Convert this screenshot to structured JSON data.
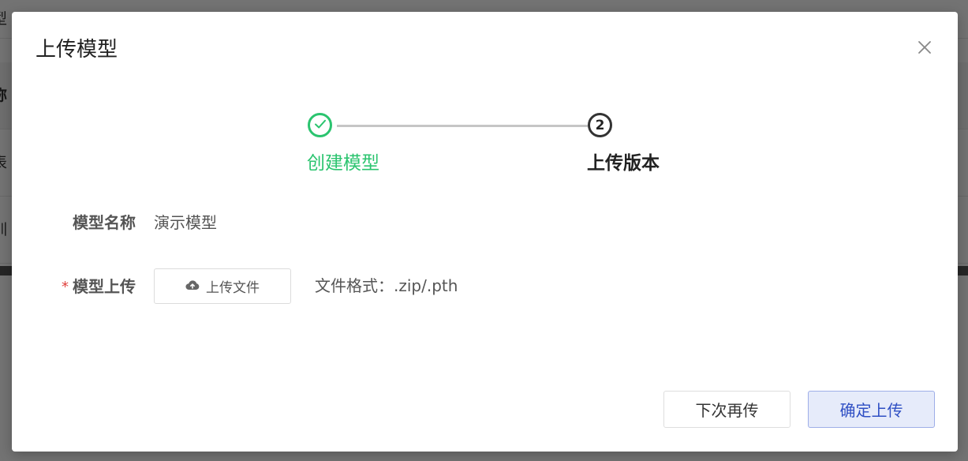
{
  "background": {
    "rows": [
      "型",
      "称",
      "表",
      "训"
    ]
  },
  "modal": {
    "title": "上传模型",
    "close_icon": "close-icon",
    "steps": [
      {
        "label": "创建模型",
        "status": "finish",
        "icon": "check-icon",
        "color": "#2bc46f"
      },
      {
        "label": "上传版本",
        "status": "process",
        "number": "2",
        "color": "#222222"
      }
    ],
    "form": {
      "name_label": "模型名称",
      "name_value": "演示模型",
      "upload_required": "*",
      "upload_label": "模型上传",
      "upload_button_label": "上传文件",
      "upload_icon": "cloud-upload-icon",
      "format_hint": "文件格式：.zip/.pth"
    },
    "footer": {
      "later_label": "下次再传",
      "confirm_label": "确定上传"
    }
  }
}
